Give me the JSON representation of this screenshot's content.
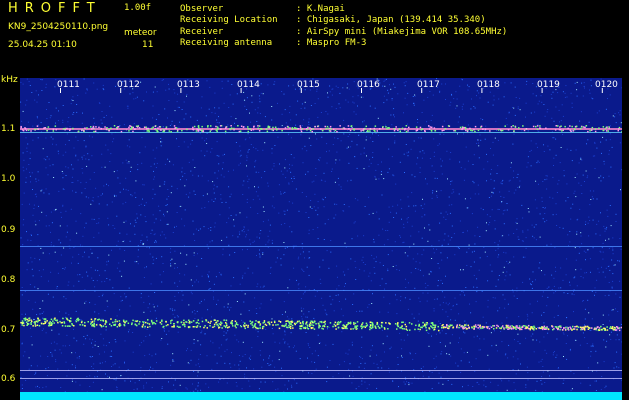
{
  "header": {
    "logo": "HROFFT",
    "version": "1.00f",
    "filename": "KN9_2504250110.png",
    "datetime": "25.04.25 01:10",
    "mode_label": "meteor",
    "count": "11",
    "info": [
      {
        "key": "Observer",
        "value": ": K.Nagai"
      },
      {
        "key": "Receiving Location",
        "value": ": Chigasaki, Japan (139.414 35.340)"
      },
      {
        "key": "Receiver",
        "value": ": AirSpy mini (Miakejima VOR 108.65MHz)"
      },
      {
        "key": "Receiving antenna",
        "value": ": Maspro FM-3"
      }
    ]
  },
  "plot": {
    "y_unit": "kHz",
    "y_ticks": [
      "1.1",
      "1.0",
      "0.9",
      "0.8",
      "0.7",
      "0.6"
    ],
    "time_ticks": [
      "0111",
      "0112",
      "0113",
      "0114",
      "0115",
      "0116",
      "0117",
      "0118",
      "0119",
      "0120"
    ],
    "colors": {
      "background": "#0a1a8c",
      "noise": "#2a6cff",
      "signal": "#7cff7c",
      "baseline": "#00e5ff"
    }
  }
}
